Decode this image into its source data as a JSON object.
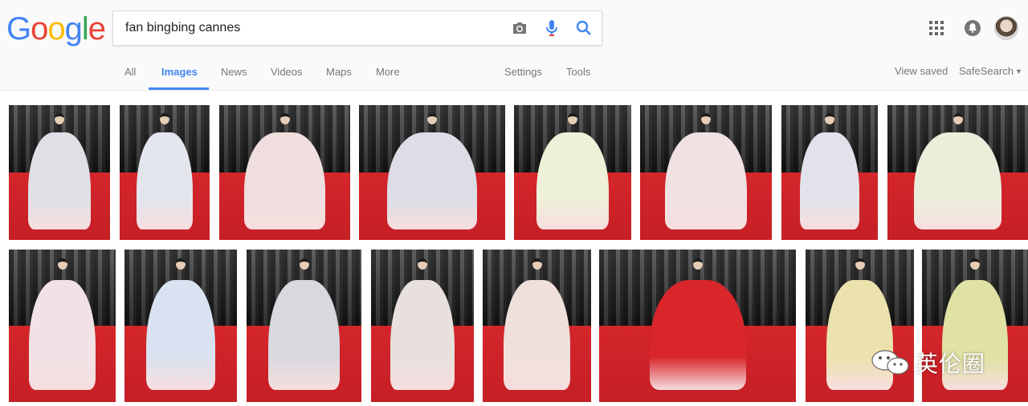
{
  "logo": {
    "letters": [
      "G",
      "o",
      "o",
      "g",
      "l",
      "e"
    ],
    "colors": [
      "#4285f4",
      "#ea4335",
      "#fbbc05",
      "#4285f4",
      "#34a853",
      "#ea4335"
    ]
  },
  "search": {
    "query": "fan bingbing cannes",
    "camera_icon": "camera-icon",
    "mic_icon": "mic-icon",
    "search_icon": "search-icon"
  },
  "header_right": {
    "apps_icon": "apps-grid-icon",
    "notifications_icon": "bell-icon",
    "avatar": "avatar"
  },
  "tabs": [
    {
      "label": "All",
      "active": false
    },
    {
      "label": "Images",
      "active": true
    },
    {
      "label": "News",
      "active": false
    },
    {
      "label": "Videos",
      "active": false
    },
    {
      "label": "Maps",
      "active": false
    },
    {
      "label": "More",
      "active": false
    },
    {
      "label": "Settings",
      "active": false
    },
    {
      "label": "Tools",
      "active": false
    }
  ],
  "right_links": {
    "view_saved": "View saved",
    "safesearch": "SafeSearch"
  },
  "results": {
    "row1": [
      {
        "dress": "#dfe0e6"
      },
      {
        "dress": "#e4e6ee"
      },
      {
        "dress": "#f0dede"
      },
      {
        "dress": "#dcdde5"
      },
      {
        "dress": "#eef0d8"
      },
      {
        "dress": "#f1e1e3"
      },
      {
        "dress": "#e2e3ea"
      },
      {
        "dress": "#eceedc"
      }
    ],
    "row2": [
      {
        "dress": "#f2e2e6"
      },
      {
        "dress": "#d9e2f0"
      },
      {
        "dress": "#d8d9df"
      },
      {
        "dress": "#e7e0dd"
      },
      {
        "dress": "#f0e0dc"
      },
      {
        "dress": "#d8262b"
      },
      {
        "dress": "#ece2ad"
      },
      {
        "dress": "#e0e2a3"
      }
    ]
  },
  "watermark": {
    "text": "英伦圈",
    "icon": "wechat-icon"
  },
  "colors": {
    "accent": "#4285f4",
    "carpet": "#cd2329"
  }
}
